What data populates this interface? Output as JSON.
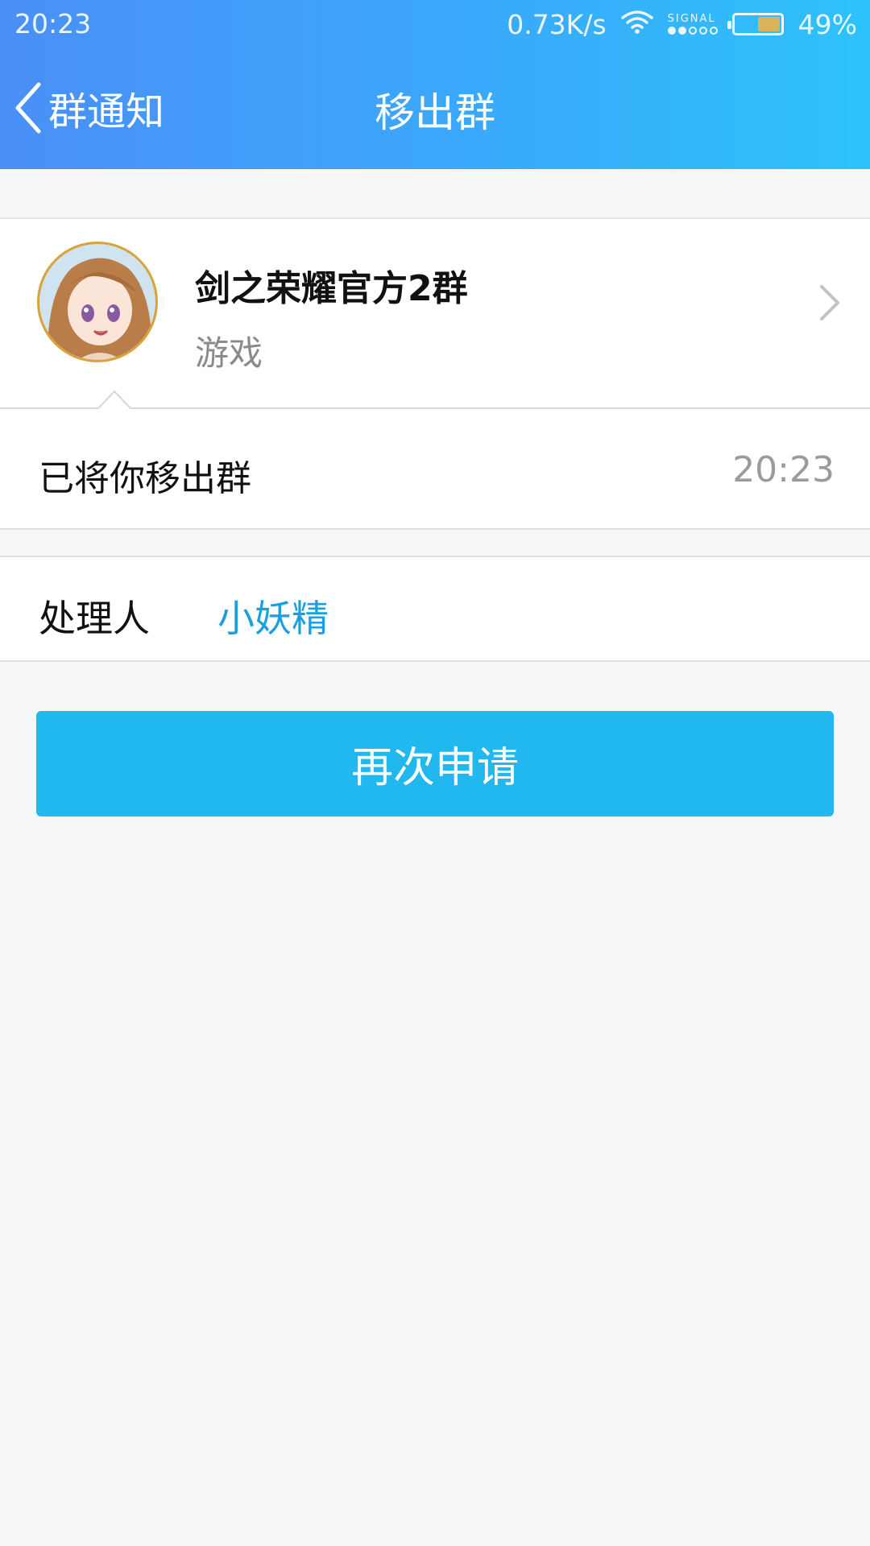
{
  "status_bar": {
    "time": "20:23",
    "net_speed": "0.73K/s",
    "signal_label": "SIGNAL",
    "battery": "49%",
    "battery_level": 0.49,
    "icons": [
      "wifi-icon",
      "signal-icon",
      "battery-icon"
    ]
  },
  "header": {
    "back_label": "群通知",
    "title": "移出群"
  },
  "group": {
    "name": "剑之荣耀官方2群",
    "category": "游戏"
  },
  "notice": {
    "message": "已将你移出群",
    "time": "20:23"
  },
  "handler": {
    "label": "处理人",
    "name": "小妖精"
  },
  "actions": {
    "reapply_label": "再次申请"
  },
  "colors": {
    "header_gradient_start": "#4a8ff7",
    "header_gradient_end": "#2ec2fb",
    "button": "#21b8ef",
    "handler_link": "#1aa0e0",
    "background": "#f6f7f9"
  }
}
